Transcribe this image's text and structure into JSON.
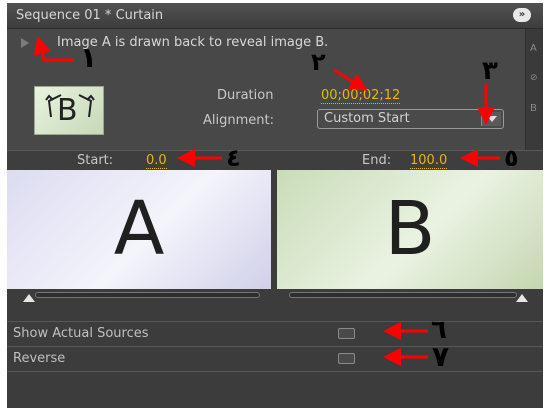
{
  "window": {
    "title": "Sequence 01 * Curtain",
    "menu_icon": "double-chevron-right-icon"
  },
  "effect": {
    "description": "Image A is drawn back to reveal image B.",
    "thumbnail_letter": "B",
    "duration_label": "Duration",
    "duration_value": "00;00;02;12",
    "alignment_label": "Alignment:",
    "alignment_value": "Custom Start"
  },
  "side_strip": [
    "A",
    "B"
  ],
  "range": {
    "start_label": "Start:",
    "start_value": "0.0",
    "end_label": "End:",
    "end_value": "100.0"
  },
  "previews": {
    "a_letter": "A",
    "b_letter": "B"
  },
  "sliders": {
    "start_fraction": 0.0,
    "end_fraction": 1.0
  },
  "options": {
    "show_actual_sources_label": "Show Actual Sources",
    "reverse_label": "Reverse"
  },
  "annotations": [
    "١",
    "٢",
    "٣",
    "٤",
    "٥",
    "٦",
    "٧"
  ],
  "colors": {
    "accent_value": "#e8b800",
    "annotation_arrow": "#ff0000"
  }
}
